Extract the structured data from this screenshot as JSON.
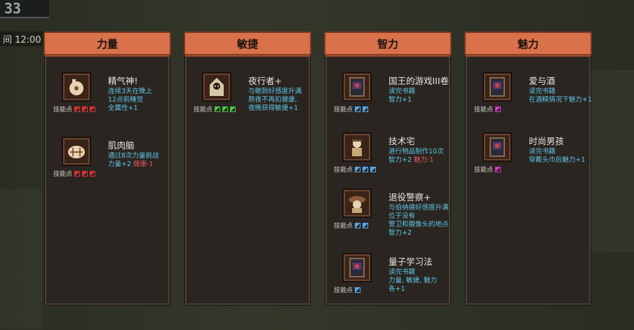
{
  "hud": {
    "day_counter": "33",
    "time_label": "间 12:00"
  },
  "colors": {
    "header": "#d9714a",
    "positive": "#5fc6e8",
    "negative": "#e8595f"
  },
  "panels": [
    {
      "title": "力量",
      "skills": [
        {
          "name": "精气神!",
          "icon": "fist-icon",
          "desc": [
            "连续3天在晚上",
            "12点前睡觉",
            "全属性+1"
          ],
          "neg": "",
          "points_label": "技能点",
          "points": 3,
          "color": "red"
        },
        {
          "name": "肌肉脑",
          "icon": "brain-muscle-icon",
          "desc": [
            "通过8次力量挑战",
            "力量+2"
          ],
          "neg": "健康-1",
          "points_label": "技能点",
          "points": 3,
          "color": "red"
        }
      ]
    },
    {
      "title": "敏捷",
      "skills": [
        {
          "name": "夜行者+",
          "icon": "hooded-figure-icon",
          "desc": [
            "与鲍勃好感度升满",
            "熬夜不再扣健康,",
            "夜晚获得敏捷+1"
          ],
          "neg": "",
          "points_label": "技能点",
          "points": 3,
          "color": "green"
        }
      ]
    },
    {
      "title": "智力",
      "skills": [
        {
          "name": "国王的游戏III卷",
          "icon": "book-icon",
          "desc": [
            "读完书籍",
            "智力+1"
          ],
          "neg": "",
          "points_label": "技能点",
          "points": 2,
          "color": "blue"
        },
        {
          "name": "技术宅",
          "icon": "engineer-icon",
          "desc": [
            "进行物品制作10次",
            "智力+2"
          ],
          "neg": "魅力-1",
          "points_label": "技能点",
          "points": 3,
          "color": "blue"
        },
        {
          "name": "退役警察+",
          "icon": "police-hat-icon",
          "desc": [
            "与伯纳德好感度升满",
            "位于没有",
            "警卫和摄像头的地点",
            "智力+2"
          ],
          "neg": "",
          "points_label": "技能点",
          "points": 2,
          "color": "blue"
        },
        {
          "name": "量子学习法",
          "icon": "book-icon",
          "desc": [
            "读完书籍",
            "力量, 敏捷, 魅力",
            "各+1"
          ],
          "neg": "",
          "points_label": "技能点",
          "points": 1,
          "color": "blue"
        }
      ]
    },
    {
      "title": "魅力",
      "skills": [
        {
          "name": "爱与酒",
          "icon": "book-icon",
          "desc": [
            "读完书籍",
            "在酒精情况下魅力+1"
          ],
          "neg": "",
          "points_label": "技能点",
          "points": 1,
          "color": "pink"
        },
        {
          "name": "时尚男孩",
          "icon": "book-icon",
          "desc": [
            "读完书籍",
            "穿戴头巾后魅力+1"
          ],
          "neg": "",
          "points_label": "技能点",
          "points": 1,
          "color": "pink"
        }
      ]
    }
  ]
}
